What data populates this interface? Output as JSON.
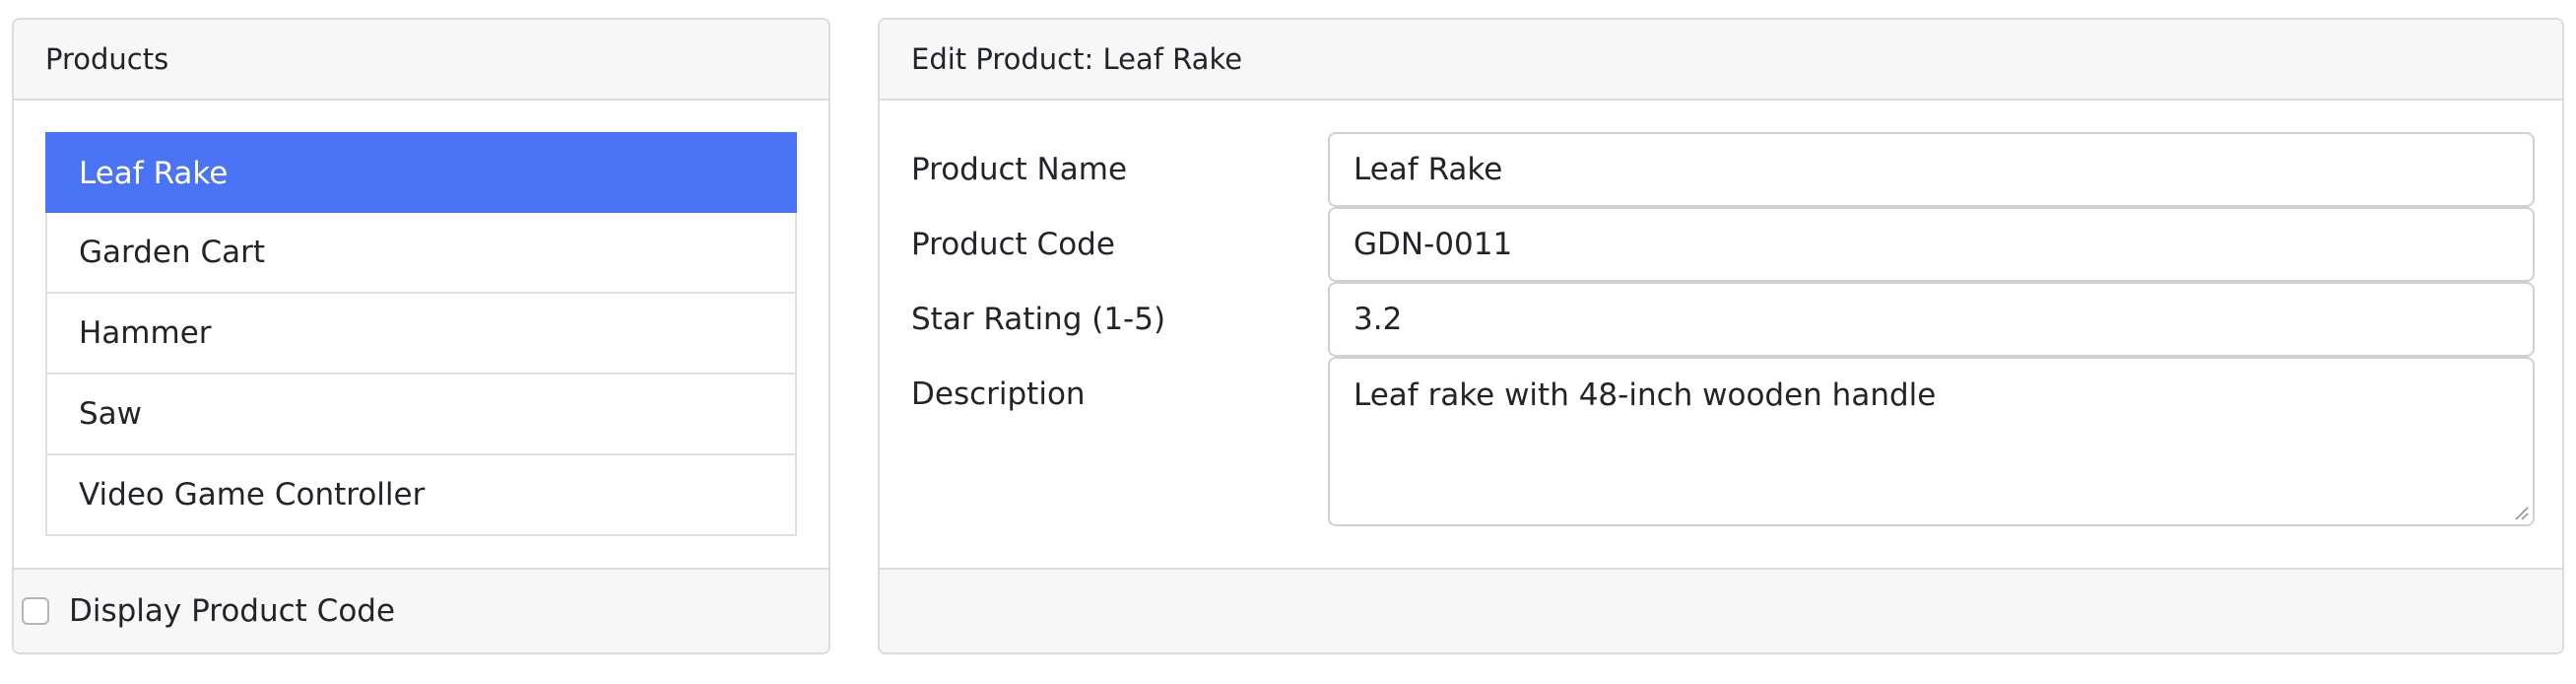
{
  "products_panel": {
    "title": "Products",
    "items": [
      {
        "label": "Leaf Rake",
        "active": true
      },
      {
        "label": "Garden Cart",
        "active": false
      },
      {
        "label": "Hammer",
        "active": false
      },
      {
        "label": "Saw",
        "active": false
      },
      {
        "label": "Video Game Controller",
        "active": false
      }
    ],
    "footer": {
      "checkbox_label": "Display Product Code",
      "checked": false
    }
  },
  "edit_panel": {
    "title": "Edit Product: Leaf Rake",
    "fields": {
      "name": {
        "label": "Product Name",
        "value": "Leaf Rake"
      },
      "code": {
        "label": "Product Code",
        "value": "GDN-0011"
      },
      "rating": {
        "label": "Star Rating (1-5)",
        "value": "3.2"
      },
      "description": {
        "label": "Description",
        "value": "Leaf rake with 48-inch wooden handle"
      }
    }
  },
  "colors": {
    "active_item": "#4a73f5",
    "header_bg": "#f7f7f7",
    "border": "#dcdcdc"
  }
}
